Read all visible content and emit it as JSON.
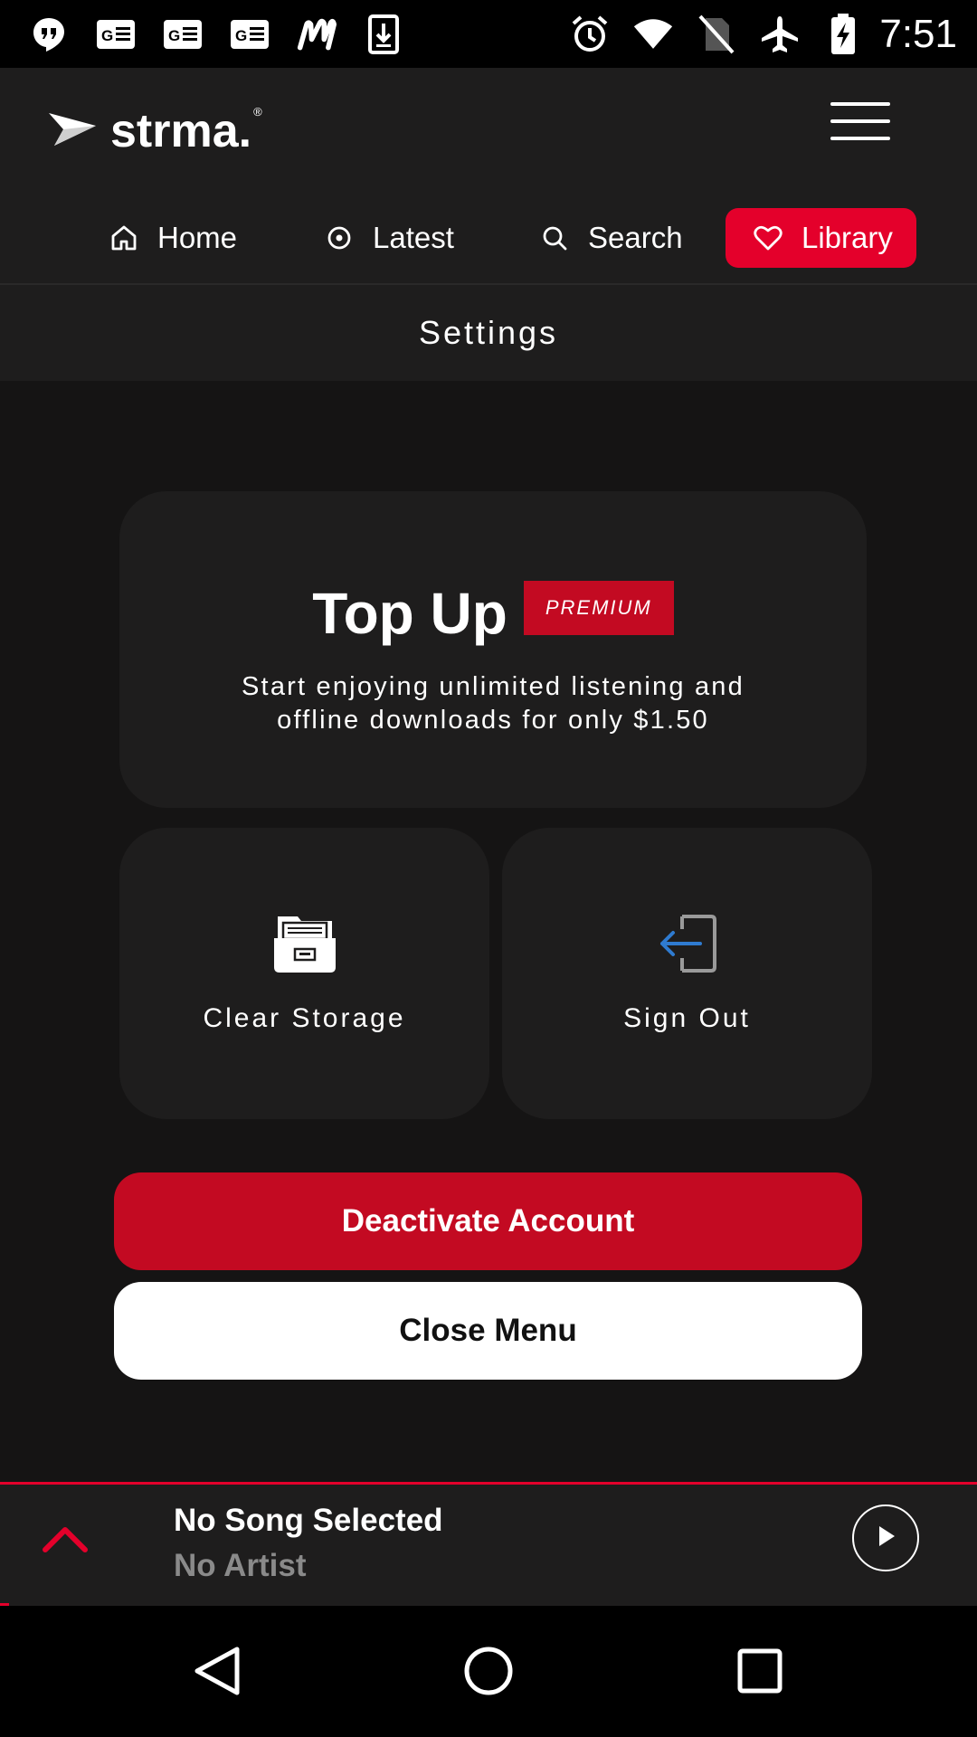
{
  "status_bar": {
    "time": "7:51",
    "left_icons": [
      "hangouts-icon",
      "news-icon",
      "news-icon",
      "news-icon",
      "m-app-icon",
      "download-icon"
    ],
    "right_icons": [
      "alarm-icon",
      "wifi-icon",
      "no-sim-icon",
      "airplane-icon",
      "battery-charging-icon"
    ]
  },
  "header": {
    "logo_text": "strma.",
    "logo_mark": "®"
  },
  "nav": {
    "home": "Home",
    "latest": "Latest",
    "search": "Search",
    "library": "Library",
    "active": "Library"
  },
  "page": {
    "title": "Settings"
  },
  "topup": {
    "title": "Top Up",
    "badge": "PREMIUM",
    "description_line1": "Start enjoying unlimited listening and",
    "description_line2": "offline downloads for only $1.50"
  },
  "tiles": {
    "clear_storage": "Clear Storage",
    "sign_out": "Sign Out"
  },
  "buttons": {
    "deactivate": "Deactivate Account",
    "close_menu": "Close Menu"
  },
  "player": {
    "song": "No Song Selected",
    "artist": "No Artist",
    "progress": 0
  },
  "colors": {
    "accent": "#e4002b",
    "danger": "#c30a22",
    "background": "#151414",
    "surface": "#1e1d1d",
    "signout_arrow": "#2f7bd0"
  }
}
